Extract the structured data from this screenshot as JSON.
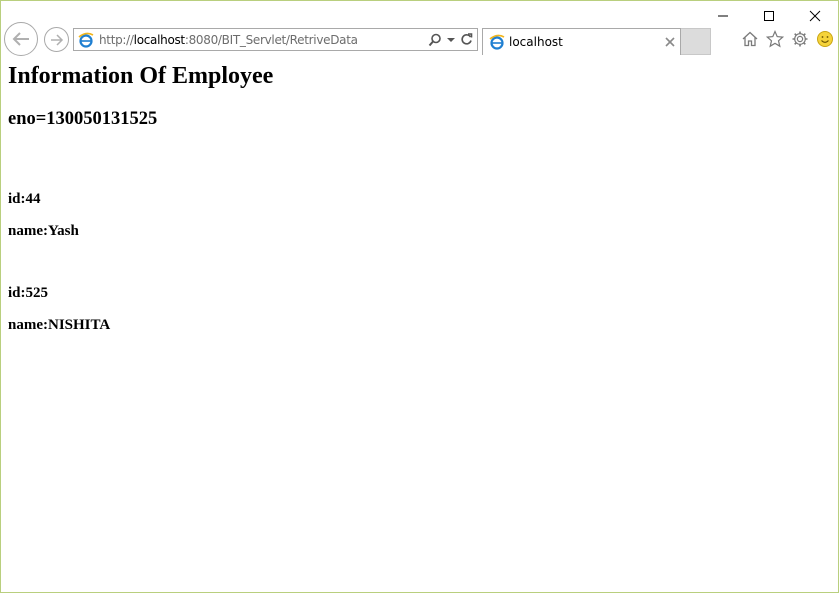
{
  "browser": {
    "address": {
      "scheme": "http://",
      "host": "localhost",
      "path": ":8080/BIT_Servlet/RetriveData"
    },
    "tab": {
      "title": "localhost"
    },
    "icons": {
      "back": "back-arrow-icon",
      "forward": "forward-arrow-icon",
      "site": "ie-page-icon",
      "search": "search-icon",
      "dropdown": "chevron-down-icon",
      "refresh": "refresh-icon",
      "close_tab": "close-icon",
      "home": "home-icon",
      "favorites": "star-icon",
      "settings": "gear-icon",
      "feedback": "smiley-icon",
      "minimize": "minimize-icon",
      "maximize": "maximize-icon",
      "close_window": "close-icon"
    },
    "colors": {
      "window_border": "#b9cf7e",
      "new_tab_bg": "#dcdcdc"
    }
  },
  "page": {
    "heading": "Information Of Employee",
    "eno": "eno=130050131525",
    "records": [
      {
        "id": "id:44",
        "name": "name:Yash"
      },
      {
        "id": "id:525",
        "name": "name:NISHITA"
      }
    ]
  }
}
